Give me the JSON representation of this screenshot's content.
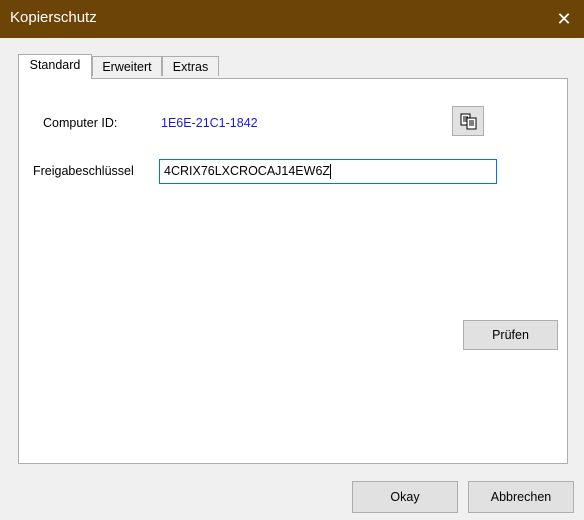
{
  "window": {
    "title": "Kopierschutz",
    "close_glyph": "✕",
    "titlebar_color": "#6d4408"
  },
  "tabs": [
    {
      "label": "Standard",
      "active": true
    },
    {
      "label": "Erweitert",
      "active": false
    },
    {
      "label": "Extras",
      "active": false
    }
  ],
  "standard": {
    "computer_id_label": "Computer ID:",
    "computer_id_value": "1E6E-21C1-1842",
    "computer_id_color": "#1a1adb",
    "copy_icon": "copy-icon",
    "key_label": "Freigabeschlüssel",
    "key_value": "4CRIX76LXCROCAJ14EW6Z",
    "check_button": "Prüfen"
  },
  "footer": {
    "ok_button": "Okay",
    "cancel_button": "Abbrechen"
  }
}
